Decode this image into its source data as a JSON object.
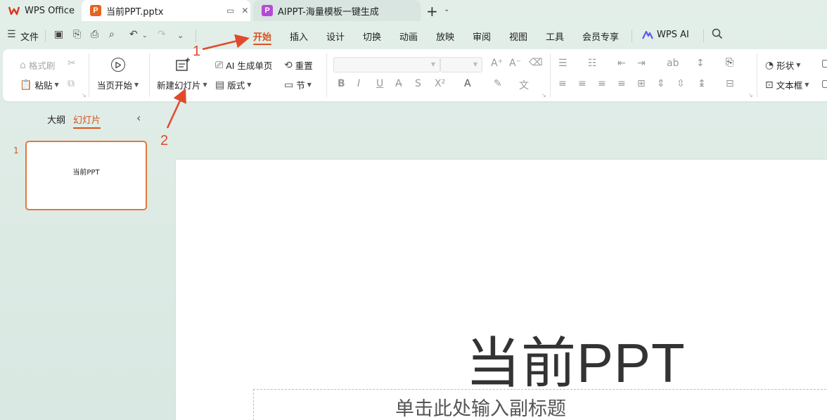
{
  "tabs": {
    "wps": "WPS Office",
    "current": "当前PPT.pptx",
    "aippt": "AIPPT-海量模板一键生成",
    "new_tab": "+"
  },
  "menu": {
    "file": "文件",
    "items": [
      "开始",
      "插入",
      "设计",
      "切换",
      "动画",
      "放映",
      "审阅",
      "视图",
      "工具",
      "会员专享"
    ],
    "wps_ai": "WPS AI"
  },
  "ribbon": {
    "format_painter": "格式刷",
    "paste": "粘贴",
    "from_current": "当页开始",
    "new_slide": "新建幻灯片",
    "ai_single": "AI 生成单页",
    "layout": "版式",
    "reset": "重置",
    "section": "节",
    "shape": "形状",
    "textbox": "文本框"
  },
  "panel": {
    "outline_tab": "大纲",
    "slides_tab": "幻灯片",
    "slide_number": "1",
    "thumb_title": "当前PPT"
  },
  "slide": {
    "title": "当前PPT",
    "subtitle_placeholder": "单击此处输入副标题"
  },
  "annotations": {
    "step1": "1",
    "step2": "2"
  },
  "colors": {
    "accent": "#d9531e",
    "annotation": "#e04a2c"
  }
}
